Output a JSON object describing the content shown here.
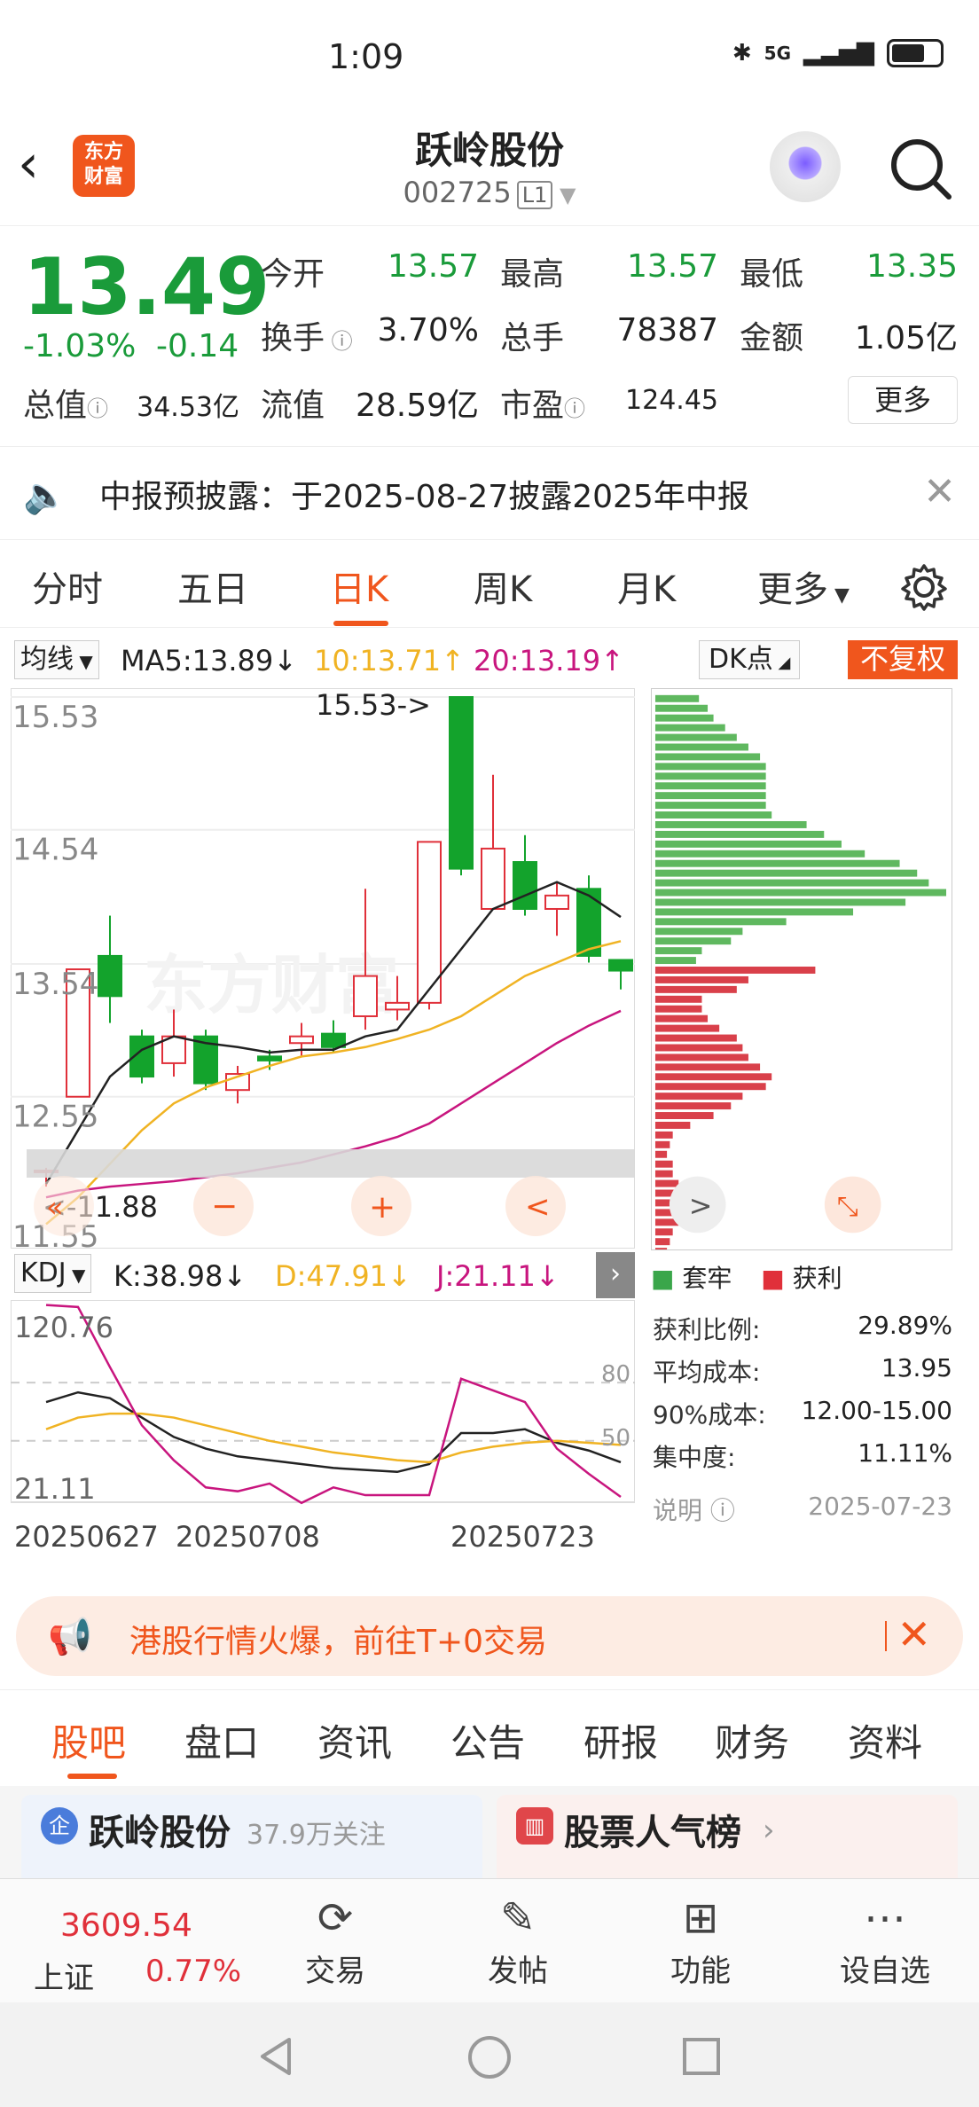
{
  "status": {
    "time": "1:09",
    "network": "5G",
    "battery": "battery-icon"
  },
  "header": {
    "title": "跃岭股份",
    "code": "002725",
    "level": "L1",
    "logo_text": "东方\n财富"
  },
  "quote": {
    "price": "13.49",
    "change_pct": "-1.03%",
    "change": "-0.14",
    "fields": [
      {
        "label": "今开",
        "value": "13.57"
      },
      {
        "label": "最高",
        "value": "13.57"
      },
      {
        "label": "最低",
        "value": "13.35"
      },
      {
        "label": "换手",
        "value": "3.70%"
      },
      {
        "label": "总手",
        "value": "78387"
      },
      {
        "label": "金额",
        "value": "1.05亿"
      },
      {
        "label": "总值",
        "value": "34.53亿"
      },
      {
        "label": "流值",
        "value": "28.59亿"
      },
      {
        "label": "市盈",
        "value": "124.45"
      }
    ],
    "more_label": "更多"
  },
  "notice": {
    "text": "中报预披露：于2025-08-27披露2025年中报"
  },
  "kline_tabs": [
    "分时",
    "五日",
    "日K",
    "周K",
    "月K",
    "更多"
  ],
  "ma_bar": {
    "selector": "均线",
    "ma5": "MA5:13.89↓",
    "ma10": "10:13.71↑",
    "ma20": "20:13.19↑",
    "dk": "DK点",
    "adjust": "不复权"
  },
  "kchart": {
    "y_labels": [
      "15.53",
      "14.54",
      "13.54",
      "12.55",
      "11.55"
    ],
    "high_marker": "15.53->",
    "low_marker": "<-11.88",
    "colors": {
      "up": "#e0303a",
      "down": "#13a32c",
      "ma5": "#222222",
      "ma10": "#f0b323",
      "ma20": "#c8157e"
    }
  },
  "chart_data": {
    "type": "candlestick",
    "ylim": [
      11.55,
      15.53
    ],
    "candles": [
      {
        "o": 12.0,
        "c": 12.0,
        "h": 12.02,
        "l": 11.88
      },
      {
        "o": 12.55,
        "c": 13.5,
        "h": 13.5,
        "l": 12.55
      },
      {
        "o": 13.6,
        "c": 13.3,
        "h": 13.9,
        "l": 13.1
      },
      {
        "o": 13.0,
        "c": 12.7,
        "h": 13.05,
        "l": 12.65
      },
      {
        "o": 12.8,
        "c": 13.0,
        "h": 13.2,
        "l": 12.7
      },
      {
        "o": 13.0,
        "c": 12.65,
        "h": 13.05,
        "l": 12.6
      },
      {
        "o": 12.6,
        "c": 12.72,
        "h": 12.78,
        "l": 12.5
      },
      {
        "o": 12.85,
        "c": 12.82,
        "h": 12.9,
        "l": 12.75
      },
      {
        "o": 12.95,
        "c": 13.0,
        "h": 13.1,
        "l": 12.85
      },
      {
        "o": 13.02,
        "c": 12.92,
        "h": 13.12,
        "l": 12.88
      },
      {
        "o": 13.15,
        "c": 13.45,
        "h": 14.1,
        "l": 13.05
      },
      {
        "o": 13.2,
        "c": 13.25,
        "h": 13.45,
        "l": 13.12
      },
      {
        "o": 13.25,
        "c": 14.45,
        "h": 14.45,
        "l": 13.2
      },
      {
        "o": 15.53,
        "c": 14.25,
        "h": 15.53,
        "l": 14.2
      },
      {
        "o": 13.95,
        "c": 14.4,
        "h": 14.95,
        "l": 13.95
      },
      {
        "o": 14.3,
        "c": 13.95,
        "h": 14.5,
        "l": 13.9
      },
      {
        "o": 13.95,
        "c": 14.05,
        "h": 14.15,
        "l": 13.75
      },
      {
        "o": 14.1,
        "c": 13.6,
        "h": 14.2,
        "l": 13.55
      },
      {
        "o": 13.57,
        "c": 13.49,
        "h": 13.57,
        "l": 13.35
      }
    ],
    "ma5": [
      11.9,
      12.3,
      12.7,
      12.9,
      13.0,
      12.95,
      12.92,
      12.88,
      12.9,
      12.9,
      13.0,
      13.05,
      13.35,
      13.65,
      13.95,
      14.05,
      14.15,
      14.05,
      13.89
    ],
    "ma10": [
      11.6,
      11.8,
      12.05,
      12.3,
      12.5,
      12.62,
      12.7,
      12.78,
      12.85,
      12.88,
      12.92,
      12.98,
      13.05,
      13.15,
      13.3,
      13.45,
      13.55,
      13.65,
      13.71
    ],
    "ma20": [
      11.8,
      11.85,
      11.88,
      11.9,
      11.92,
      11.95,
      11.98,
      12.02,
      12.06,
      12.12,
      12.18,
      12.25,
      12.35,
      12.5,
      12.65,
      12.8,
      12.95,
      13.08,
      13.19
    ]
  },
  "kdj": {
    "selector": "KDJ",
    "k": "K:38.98↓",
    "d": "D:47.91↓",
    "j": "J:21.11↓",
    "y_top": "120.76",
    "y_bottom": "21.11",
    "ref80": "80",
    "ref50": "50",
    "dates": [
      "20250627",
      "20250708",
      "20250723"
    ],
    "k_values": [
      70,
      75,
      72,
      62,
      52,
      46,
      42,
      40,
      38,
      36,
      35,
      34,
      38,
      54,
      54,
      56,
      49,
      45,
      38.98
    ],
    "d_values": [
      56,
      62,
      64,
      64,
      62,
      58,
      54,
      50,
      47,
      44,
      42,
      40,
      39,
      44,
      47,
      49,
      50,
      49,
      47.91
    ],
    "j_values": [
      120,
      119,
      88,
      58,
      40,
      26,
      24,
      28,
      18,
      26,
      22,
      22,
      22,
      82,
      76,
      70,
      46,
      33,
      21.11
    ]
  },
  "chip": {
    "legend_trapped": "套牢",
    "legend_profit": "获利",
    "rows": [
      {
        "label": "获利比例:",
        "value": "29.89%"
      },
      {
        "label": "平均成本:",
        "value": "13.95"
      },
      {
        "label": "90%成本:",
        "value": "12.00-15.00"
      },
      {
        "label": "集中度:",
        "value": "11.11%"
      }
    ],
    "note_label": "说明",
    "date": "2025-07-23",
    "green_bars": [
      0.15,
      0.18,
      0.2,
      0.24,
      0.28,
      0.32,
      0.36,
      0.38,
      0.38,
      0.38,
      0.38,
      0.38,
      0.4,
      0.52,
      0.58,
      0.64,
      0.72,
      0.84,
      0.9,
      0.94,
      1.0,
      0.86,
      0.68,
      0.45,
      0.3,
      0.26,
      0.16,
      0.14
    ],
    "red_bars": [
      0.55,
      0.32,
      0.28,
      0.16,
      0.16,
      0.18,
      0.22,
      0.28,
      0.3,
      0.32,
      0.36,
      0.4,
      0.38,
      0.3,
      0.26,
      0.2,
      0.12,
      0.06,
      0.05,
      0.04,
      0.06,
      0.06,
      0.08,
      0.1,
      0.1,
      0.09,
      0.08,
      0.06,
      0.05,
      0.04
    ]
  },
  "promo": {
    "text": "港股行情火爆，前往T+0交易"
  },
  "bottom_tabs": [
    "股吧",
    "盘口",
    "资讯",
    "公告",
    "研报",
    "财务",
    "资料"
  ],
  "cards": [
    {
      "title": "跃岭股份",
      "sub": "37.9万关注"
    },
    {
      "title": "股票人气榜",
      "sub": ""
    }
  ],
  "bottom_nav": {
    "index_value": "3609.54",
    "index_name": "上证",
    "index_pct": "0.77%",
    "items": [
      "交易",
      "发帖",
      "功能",
      "设自选"
    ]
  }
}
